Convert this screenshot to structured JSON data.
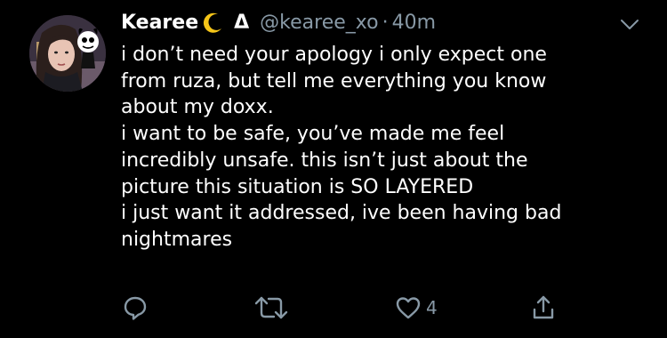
{
  "tweet": {
    "display_name": "Kearee",
    "name_emoji": "🌙",
    "name_symbol": "Δ",
    "handle": "@kearee_xo",
    "separator": "·",
    "time": "40m",
    "text": "i don’t need your apology i only expect one\nfrom ruza, but tell me everything you know\nabout my doxx.\ni want to be safe, you’ve made me feel\nincredibly unsafe. this isn’t just about the\npicture this situation is SO LAYERED\ni just want it addressed, ive been having  bad\nnightmares",
    "actions": {
      "reply_icon": "reply-icon",
      "retweet_icon": "retweet-icon",
      "like_icon": "heart-icon",
      "like_count": "4",
      "share_icon": "share-icon"
    }
  },
  "colors": {
    "background": "#000000",
    "primary_text": "#ffffff",
    "secondary_text": "#8899a6",
    "moon": "#f5c518"
  }
}
